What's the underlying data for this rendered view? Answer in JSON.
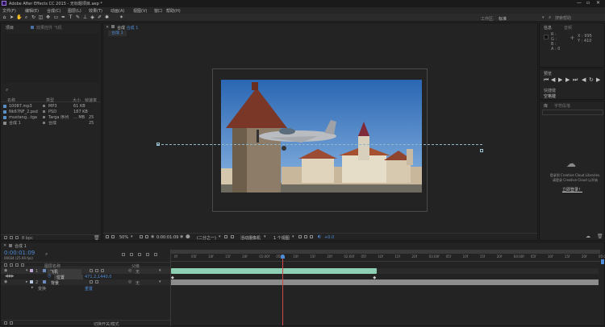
{
  "window": {
    "title": "Adobe After Effects CC 2015 - 无标题项目.aep *",
    "controls": [
      "—",
      "▫",
      "✕"
    ]
  },
  "menu": [
    "文件(F)",
    "编辑(E)",
    "合成(C)",
    "图层(L)",
    "效果(T)",
    "动画(A)",
    "视图(V)",
    "窗口",
    "帮助(H)"
  ],
  "toolbar": {
    "workspace_label": "工作区:",
    "workspace_value": "标准",
    "search_placeholder": "搜索帮助"
  },
  "project": {
    "tabs": [
      "项目",
      "效果控件 飞机"
    ],
    "columns": [
      "名称",
      "类型",
      "大小",
      "帧速率"
    ],
    "items": [
      {
        "name": "10087.mp3",
        "type": "MP3",
        "size": "61 KB",
        "fps": ""
      },
      {
        "name": "Nk67NF_2.psd",
        "type": "PSD",
        "size": "187 KB",
        "fps": ""
      },
      {
        "name": "mustang...tga",
        "type": "Targa 序列",
        "size": "... MB",
        "fps": "25"
      },
      {
        "name": "合成 1",
        "type": "合成",
        "size": "",
        "fps": "25"
      }
    ],
    "footer_bpc": "8 bpc"
  },
  "composition": {
    "tab_prefix": "合成",
    "tab_name": "合成 1",
    "sub_tab": "合成 1",
    "zoom": "50%",
    "timecode": "0:00:01:09",
    "resolution": "(二分之一)",
    "camera": "活动摄像机",
    "views": "1 个视图",
    "offset": "+0.0"
  },
  "info": {
    "tabs": [
      "信息",
      "音频"
    ],
    "values": {
      "R": "R :",
      "G": "G :",
      "B": "B :",
      "A": "A : 0",
      "X": "X : 995",
      "Y": "Y : 410"
    }
  },
  "preview": {
    "title": "预览",
    "shortcut_label": "快捷键",
    "shortcut_value": "空格键"
  },
  "library": {
    "tabs": [
      "库",
      "字符段落"
    ],
    "message_1": "登录到 Creative Cloud Libraries.",
    "message_2": "请登录 Creative Cloud 以开始",
    "login_button": "立即登录！"
  },
  "timeline": {
    "tab": "合成 1",
    "timecode": "0:00:01:09",
    "frame_info": "00034 (25.00 fps)",
    "columns": [
      "图层名称",
      "父级"
    ],
    "ruler": [
      "0f",
      "05f",
      "10f",
      "15f",
      "20f",
      "01:00f",
      "05f",
      "10f",
      "15f",
      "20f",
      "02:00f",
      "05f",
      "10f",
      "15f",
      "20f",
      "03:00f",
      "05f",
      "10f",
      "15f",
      "20f",
      "04:00f",
      "05f",
      "10f",
      "15f",
      "20f",
      "05:0"
    ],
    "layers": [
      {
        "num": "1",
        "name": "飞机",
        "parent": "无"
      },
      {
        "prop": "位置",
        "value": "471.2,1440.0"
      },
      {
        "num": "2",
        "name": "背景",
        "parent": "无"
      },
      {
        "prop": "变换",
        "value": "重置"
      }
    ],
    "footer": "切换开关/模式",
    "playhead_fraction": 0.26,
    "bar1_end_fraction": 0.48
  },
  "colors": {
    "accent": "#4f8bd6",
    "track_green": "#8fd0b5",
    "track_gray": "#8c8c8c",
    "playhead": "#d04a4a"
  }
}
